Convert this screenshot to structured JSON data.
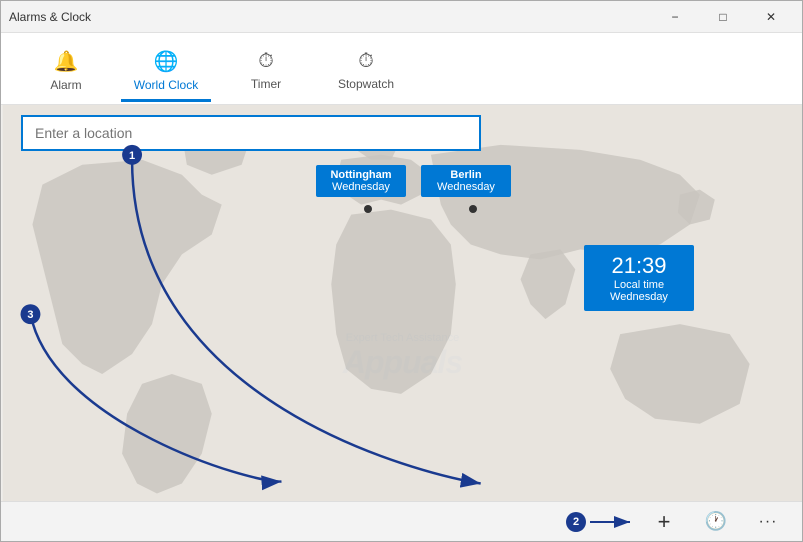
{
  "titleBar": {
    "title": "Alarms & Clock",
    "minimizeLabel": "−",
    "maximizeLabel": "□",
    "closeLabel": "✕"
  },
  "nav": {
    "tabs": [
      {
        "id": "alarm",
        "label": "Alarm",
        "icon": "🔔",
        "active": false
      },
      {
        "id": "world-clock",
        "label": "World Clock",
        "icon": "🌐",
        "active": true
      },
      {
        "id": "timer",
        "label": "Timer",
        "icon": "⏱",
        "active": false
      },
      {
        "id": "stopwatch",
        "label": "Stopwatch",
        "icon": "⏱",
        "active": false
      }
    ]
  },
  "worldClock": {
    "searchPlaceholder": "Enter a location",
    "locations": [
      {
        "id": "nottingham",
        "city": "Nottingham",
        "day": "Wednesday"
      },
      {
        "id": "berlin",
        "city": "Berlin",
        "day": "Wednesday"
      }
    ],
    "localTime": {
      "time": "21:39",
      "label": "Local time",
      "day": "Wednesday"
    }
  },
  "toolbar": {
    "addLabel": "+",
    "clockLabel": "🕐",
    "moreLabel": "···"
  },
  "annotations": {
    "badge1": "1",
    "badge2": "2",
    "badge3": "3"
  },
  "watermark": {
    "text": "Expert Tech Assistance",
    "brand": "Appuals"
  }
}
